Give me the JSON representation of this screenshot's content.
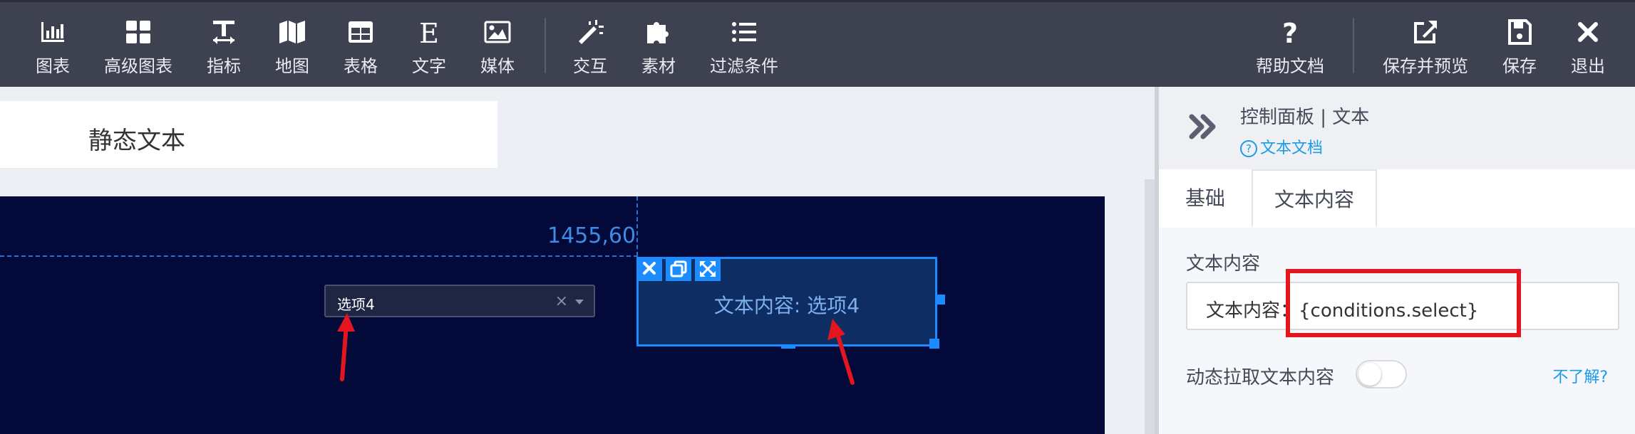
{
  "toolbar": {
    "items": [
      {
        "label": "图表",
        "icon": "bar-chart-icon"
      },
      {
        "label": "高级图表",
        "icon": "grid-icon"
      },
      {
        "label": "指标",
        "icon": "text-height-icon"
      },
      {
        "label": "地图",
        "icon": "map-icon"
      },
      {
        "label": "表格",
        "icon": "table-icon"
      },
      {
        "label": "文字",
        "icon": "letter-e-icon"
      },
      {
        "label": "媒体",
        "icon": "image-icon"
      },
      {
        "label": "交互",
        "icon": "magic-wand-icon"
      },
      {
        "label": "素材",
        "icon": "puzzle-icon"
      },
      {
        "label": "过滤条件",
        "icon": "list-icon"
      }
    ],
    "right_items": [
      {
        "label": "帮助文档",
        "icon": "question-icon"
      },
      {
        "label": "保存并预览",
        "icon": "external-link-icon"
      },
      {
        "label": "保存",
        "icon": "save-icon"
      },
      {
        "label": "退出",
        "icon": "close-icon"
      }
    ]
  },
  "page": {
    "title": "静态文本"
  },
  "canvas": {
    "coordinate_readout": "1455,60",
    "select": {
      "value": "选项4",
      "clear": "×"
    },
    "text_widget": {
      "text": "文本内容: 选项4"
    }
  },
  "panel": {
    "title": "控制面板 | 文本",
    "doc_link": "文本文档",
    "tabs": [
      {
        "label": "基础",
        "active": false
      },
      {
        "label": "文本内容",
        "active": true
      }
    ],
    "content_field": {
      "label": "文本内容",
      "value": "文本内容：{conditions.select}"
    },
    "dynamic_toggle": {
      "label": "动态拉取文本内容",
      "on": false,
      "help": "不了解?"
    }
  },
  "colors": {
    "toolbar_bg": "#3d4150",
    "canvas_bg": "#030a3a",
    "accent_blue": "#1a8cff",
    "link_blue": "#1a9be8",
    "annotation_red": "#e3151f"
  }
}
